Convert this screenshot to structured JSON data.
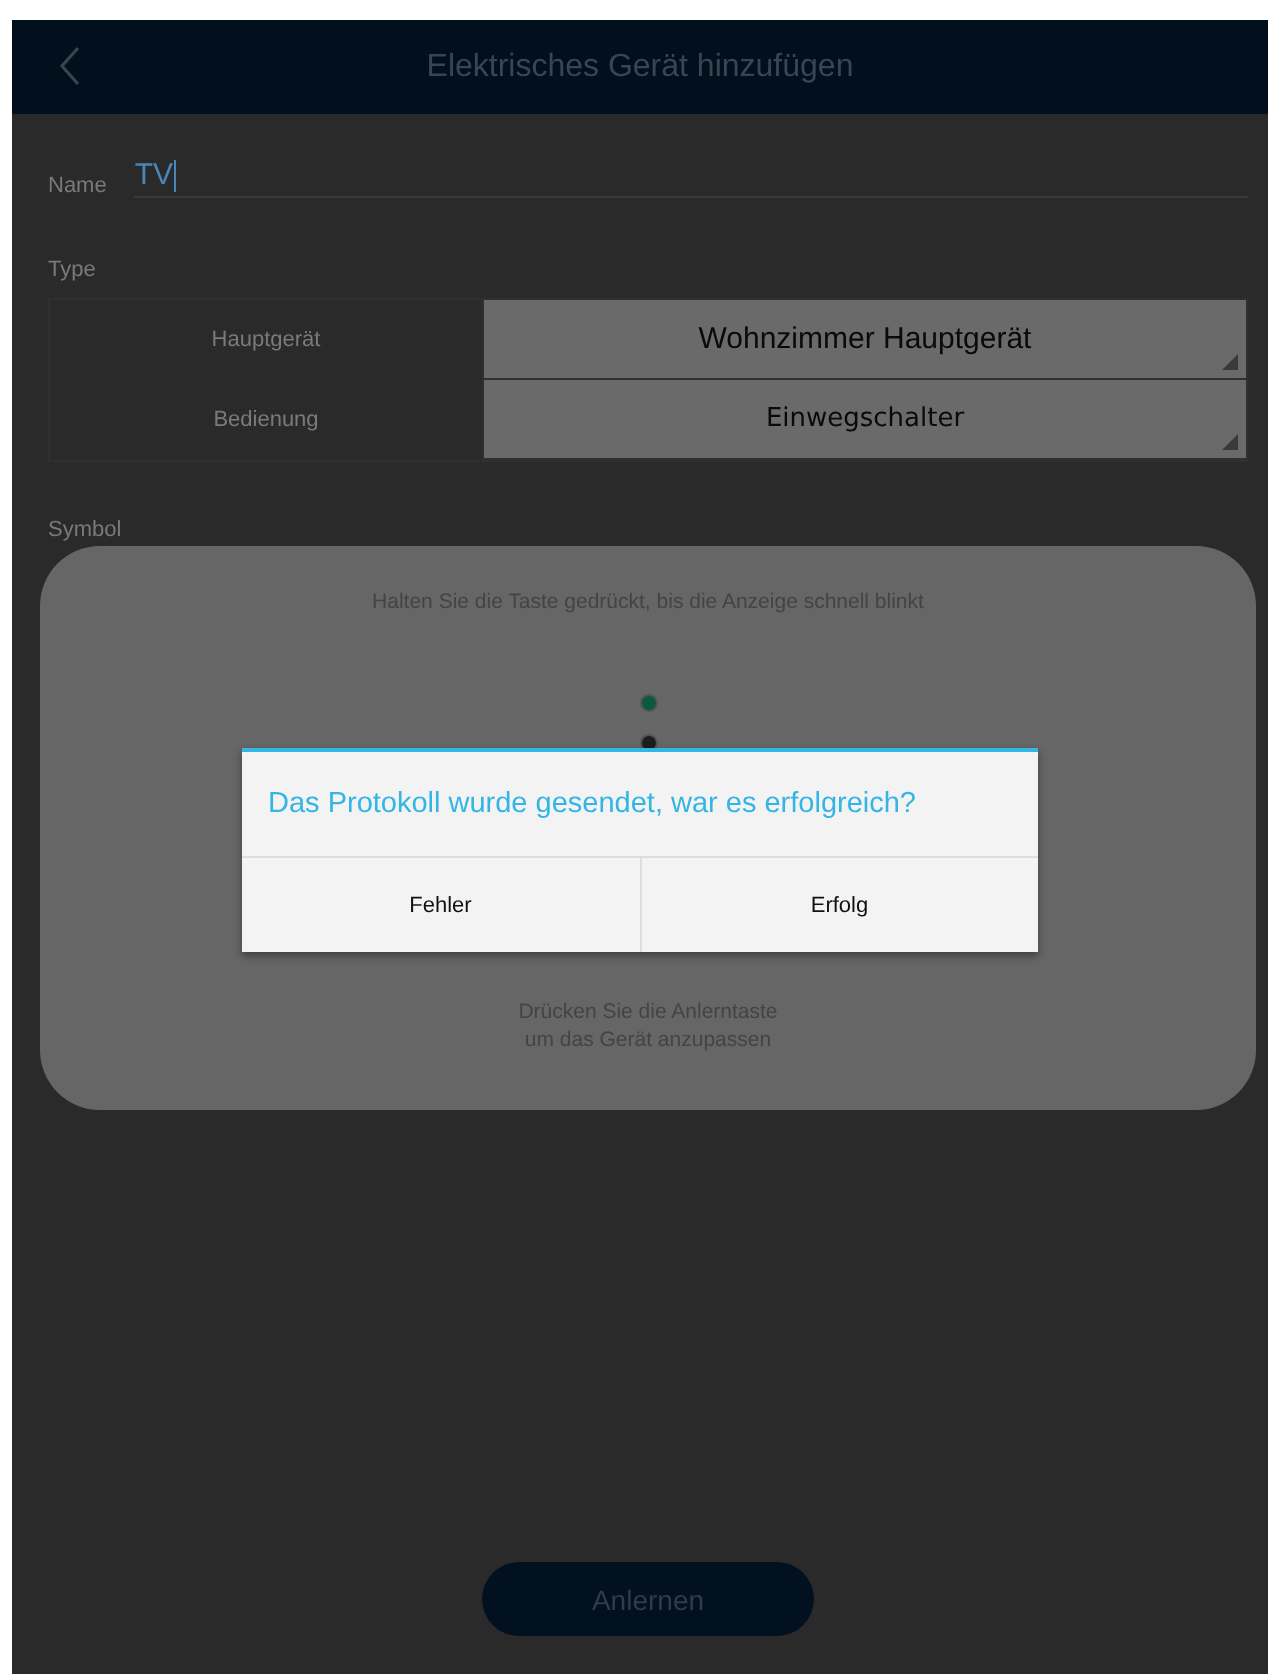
{
  "header": {
    "title": "Elektrisches Gerät hinzufügen"
  },
  "name_field": {
    "label": "Name",
    "value": "TV"
  },
  "type_section": {
    "label": "Type",
    "rows": [
      {
        "label": "Hauptgerät",
        "value": "Wohnzimmer Hauptgerät",
        "kind": "sans"
      },
      {
        "label": "Bedienung",
        "value": "Einwegschalter",
        "kind": "wide"
      }
    ]
  },
  "symbol_section": {
    "label": "Symbol"
  },
  "learn_panel": {
    "hint": "Halten Sie die Taste gedrückt, bis die Anzeige schnell blinkt",
    "indicators": [
      {
        "color": "#0b5a3c"
      },
      {
        "color": "#1e1e1e"
      }
    ],
    "instruction": "Drücken Sie die Anlerntaste\num das Gerät anzupassen"
  },
  "dialog": {
    "message": "Das Protokoll wurde gesendet, war es erfolgreich?",
    "buttons": [
      "Fehler",
      "Erfolg"
    ]
  },
  "learn_button": {
    "label": "Anlernen"
  }
}
